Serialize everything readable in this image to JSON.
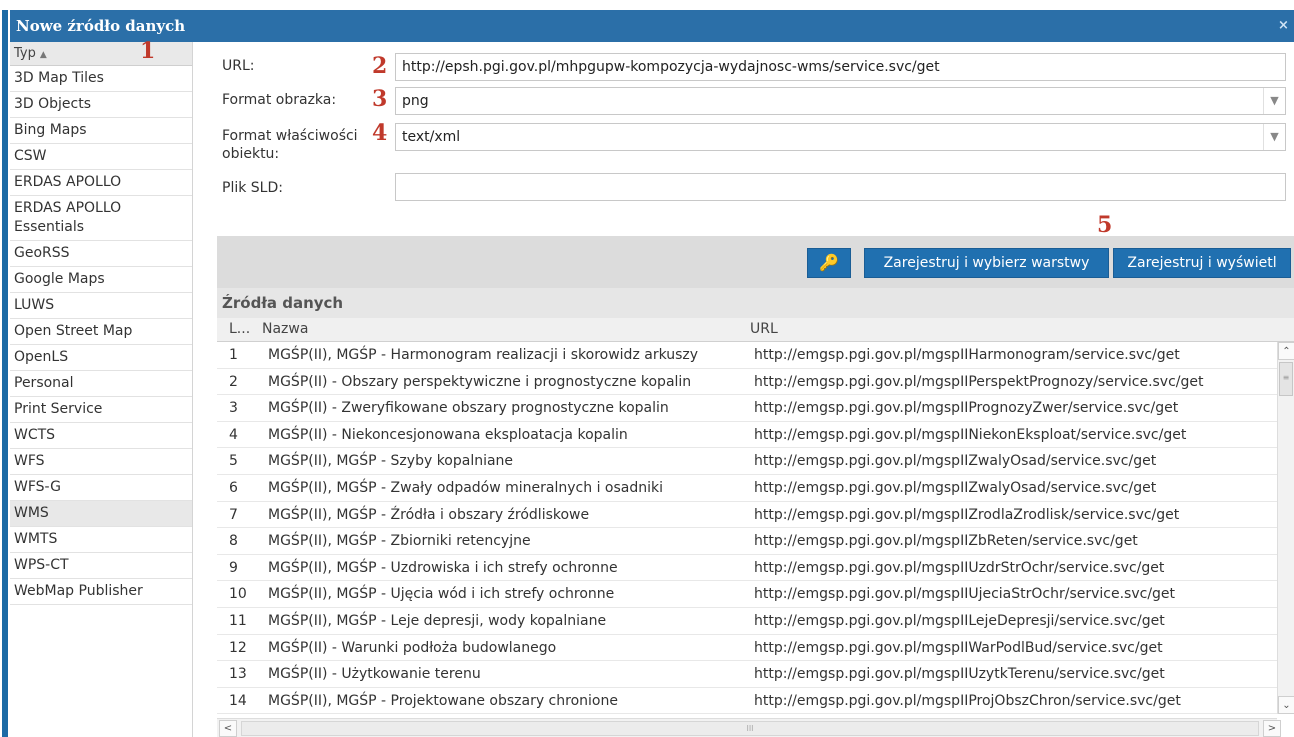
{
  "window": {
    "title": "Nowe źródło danych",
    "close_label": "×"
  },
  "markers": {
    "m1": "1",
    "m2": "2",
    "m3": "3",
    "m4": "4",
    "m5": "5"
  },
  "sidebar": {
    "header": "Typ",
    "sort_icon": "▲",
    "items": [
      "3D Map Tiles",
      "3D Objects",
      "Bing Maps",
      "CSW",
      "ERDAS APOLLO",
      "ERDAS APOLLO Essentials",
      "GeoRSS",
      "Google Maps",
      "LUWS",
      "Open Street Map",
      "OpenLS",
      "Personal",
      "Print Service",
      "WCTS",
      "WFS",
      "WFS-G",
      "WMS",
      "WMTS",
      "WPS-CT",
      "WebMap Publisher"
    ],
    "selected": "WMS"
  },
  "form": {
    "url_label": "URL:",
    "url_value": "http://epsh.pgi.gov.pl/mhpgupw-kompozycja-wydajnosc-wms/service.svc/get",
    "image_format_label": "Format obrazka:",
    "image_format_value": "png",
    "feature_format_label": "Format właściwości obiektu:",
    "feature_format_value": "text/xml",
    "sld_label": "Plik SLD:",
    "sld_value": ""
  },
  "toolbar": {
    "key_icon": "key-icon",
    "key_glyph": "🔑",
    "register_select_label": "Zarejestruj i wybierz warstwy",
    "register_show_label": "Zarejestruj i wyświetl"
  },
  "grid": {
    "title": "Źródła danych",
    "columns": [
      "L...",
      "Nazwa",
      "URL"
    ],
    "rows": [
      [
        "1",
        "MGŚP(II), MGŚP - Harmonogram realizacji i skorowidz arkuszy",
        "http://emgsp.pgi.gov.pl/mgspIIHarmonogram/service.svc/get"
      ],
      [
        "2",
        "MGŚP(II) - Obszary perspektywiczne i prognostyczne kopalin",
        "http://emgsp.pgi.gov.pl/mgspIIPerspektPrognozy/service.svc/get"
      ],
      [
        "3",
        "MGŚP(II) - Zweryfikowane obszary prognostyczne kopalin",
        "http://emgsp.pgi.gov.pl/mgspIIPrognozyZwer/service.svc/get"
      ],
      [
        "4",
        "MGŚP(II) - Niekoncesjonowana eksploatacja kopalin",
        "http://emgsp.pgi.gov.pl/mgspIINiekonEksploat/service.svc/get"
      ],
      [
        "5",
        "MGŚP(II), MGŚP - Szyby kopalniane",
        "http://emgsp.pgi.gov.pl/mgspIIZwalyOsad/service.svc/get"
      ],
      [
        "6",
        "MGŚP(II), MGŚP - Zwały odpadów mineralnych i osadniki",
        "http://emgsp.pgi.gov.pl/mgspIIZwalyOsad/service.svc/get"
      ],
      [
        "7",
        "MGŚP(II), MGŚP - Źródła i obszary źródliskowe",
        "http://emgsp.pgi.gov.pl/mgspIIZrodlaZrodlisk/service.svc/get"
      ],
      [
        "8",
        "MGŚP(II), MGŚP - Zbiorniki retencyjne",
        "http://emgsp.pgi.gov.pl/mgspIIZbReten/service.svc/get"
      ],
      [
        "9",
        "MGŚP(II), MGŚP - Uzdrowiska i ich strefy ochronne",
        "http://emgsp.pgi.gov.pl/mgspIIUzdrStrOchr/service.svc/get"
      ],
      [
        "10",
        "MGŚP(II), MGŚP - Ujęcia wód i ich strefy ochronne",
        "http://emgsp.pgi.gov.pl/mgspIIUjeciaStrOchr/service.svc/get"
      ],
      [
        "11",
        "MGŚP(II), MGŚP - Leje depresji, wody kopalniane",
        "http://emgsp.pgi.gov.pl/mgspIILejeDepresji/service.svc/get"
      ],
      [
        "12",
        "MGŚP(II) - Warunki podłoża budowlanego",
        "http://emgsp.pgi.gov.pl/mgspIIWarPodlBud/service.svc/get"
      ],
      [
        "13",
        "MGŚP(II) - Użytkowanie terenu",
        "http://emgsp.pgi.gov.pl/mgspIIUzytkTerenu/service.svc/get"
      ],
      [
        "14",
        "MGŚP(II), MGŚP - Projektowane obszary chronione",
        "http://emgsp.pgi.gov.pl/mgspIIProjObszChron/service.svc/get"
      ]
    ]
  },
  "scrollbars": {
    "up": "⌃",
    "down": "⌄",
    "left": "<",
    "right": ">",
    "grip_v": "≡",
    "grip_h": "III"
  },
  "colors": {
    "accent": "#2070b0",
    "titlebar": "#2b6fa8",
    "marker": "#c0392b"
  }
}
